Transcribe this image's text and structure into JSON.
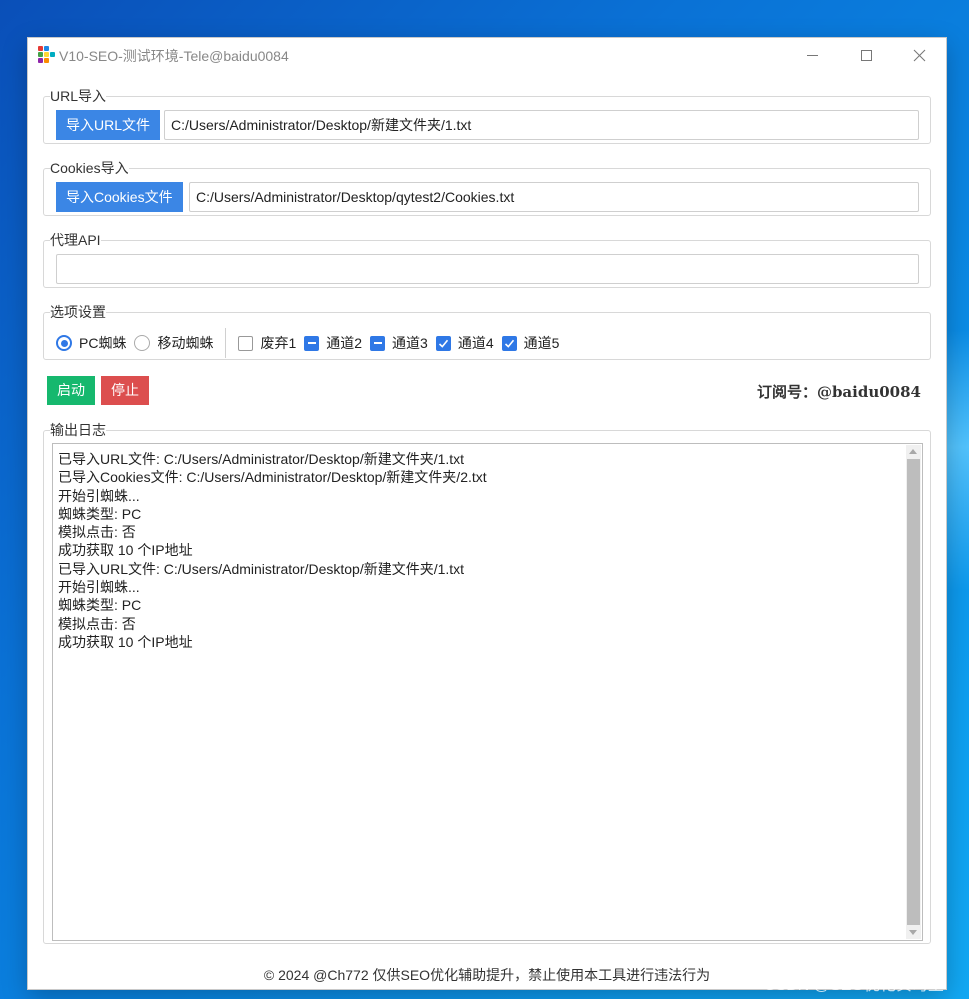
{
  "window": {
    "title": "V10-SEO-测试环境-Tele@baidu0084"
  },
  "url_import": {
    "legend": "URL导入",
    "button_label": "导入URL文件",
    "path_value": "C:/Users/Administrator/Desktop/新建文件夹/1.txt"
  },
  "cookies_import": {
    "legend": "Cookies导入",
    "button_label": "导入Cookies文件",
    "path_value": "C:/Users/Administrator/Desktop/qytest2/Cookies.txt"
  },
  "proxy_api": {
    "legend": "代理API",
    "value": ""
  },
  "options": {
    "legend": "选项设置",
    "spider_types": [
      {
        "label": "PC蜘蛛",
        "selected": true
      },
      {
        "label": "移动蜘蛛",
        "selected": false
      }
    ],
    "channels": [
      {
        "label": "废弃1",
        "state": "unchecked"
      },
      {
        "label": "通道2",
        "state": "indeterminate"
      },
      {
        "label": "通道3",
        "state": "indeterminate"
      },
      {
        "label": "通道4",
        "state": "checked"
      },
      {
        "label": "通道5",
        "state": "checked"
      }
    ]
  },
  "actions": {
    "start_label": "启动",
    "stop_label": "停止",
    "subscription": "订阅号：@baidu0084"
  },
  "log": {
    "legend": "输出日志",
    "lines": [
      "已导入URL文件: C:/Users/Administrator/Desktop/新建文件夹/1.txt",
      "已导入Cookies文件: C:/Users/Administrator/Desktop/新建文件夹/2.txt",
      "开始引蜘蛛...",
      "蜘蛛类型: PC",
      "模拟点击: 否",
      "成功获取 10 个IP地址",
      "已导入URL文件: C:/Users/Administrator/Desktop/新建文件夹/1.txt",
      "开始引蜘蛛...",
      "蜘蛛类型: PC",
      "模拟点击: 否",
      "成功获取 10 个IP地址"
    ]
  },
  "footer": {
    "text": "© 2024 @Ch772 仅供SEO优化辅助提升，禁止使用本工具进行违法行为"
  },
  "watermark": {
    "text": "CSDN @SEO优化实习生"
  },
  "colors": {
    "primary_blue": "#3b86e5",
    "start_green": "#16b86e",
    "stop_red": "#dc4e4e",
    "checkbox_blue": "#2f78e6"
  }
}
